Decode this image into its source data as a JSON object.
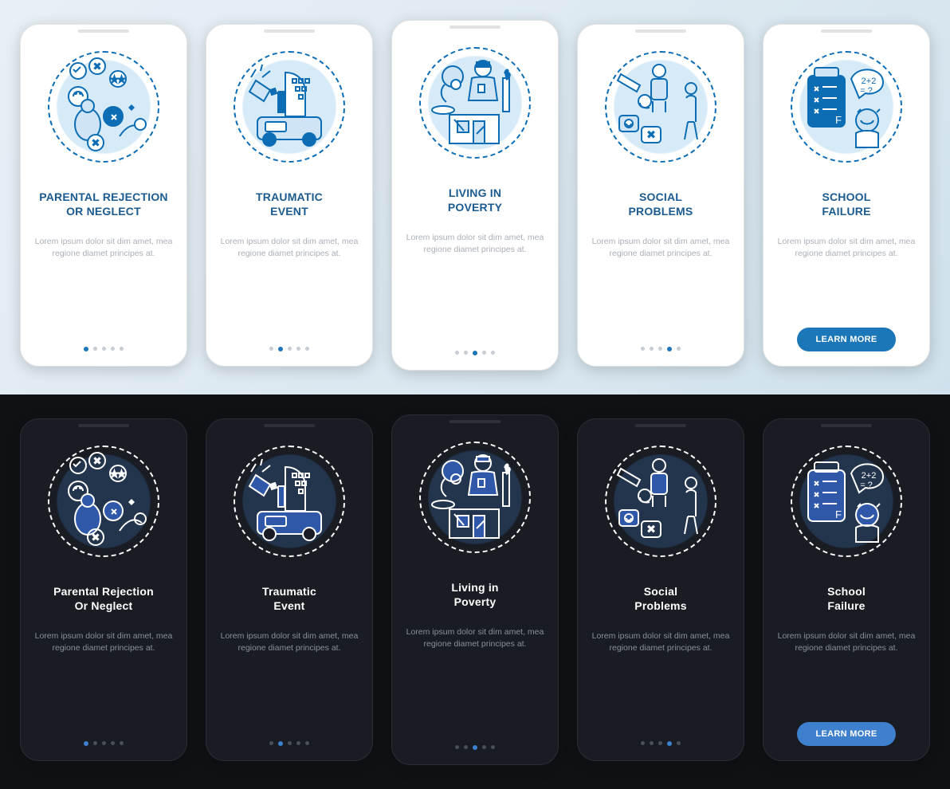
{
  "common_body": "Lorem ipsum dolor sit dim amet, mea regione diamet principes at.",
  "learn_more": "LEARN MORE",
  "light": {
    "slides": [
      {
        "title_l1": "PARENTAL REJECTION",
        "title_l2": "OR NEGLECT",
        "active": 0
      },
      {
        "title_l1": "TRAUMATIC",
        "title_l2": "EVENT",
        "active": 1
      },
      {
        "title_l1": "LIVING IN",
        "title_l2": "POVERTY",
        "active": 2
      },
      {
        "title_l1": "SOCIAL",
        "title_l2": "PROBLEMS",
        "active": 3
      },
      {
        "title_l1": "SCHOOL",
        "title_l2": "FAILURE",
        "active": 4,
        "cta": true
      }
    ]
  },
  "dark": {
    "slides": [
      {
        "title_l1": "Parental Rejection",
        "title_l2": "Or Neglect",
        "active": 0
      },
      {
        "title_l1": "Traumatic",
        "title_l2": "Event",
        "active": 1
      },
      {
        "title_l1": "Living in",
        "title_l2": "Poverty",
        "active": 2
      },
      {
        "title_l1": "Social",
        "title_l2": "Problems",
        "active": 3
      },
      {
        "title_l1": "School",
        "title_l2": "Failure",
        "active": 4,
        "cta": true
      }
    ]
  }
}
